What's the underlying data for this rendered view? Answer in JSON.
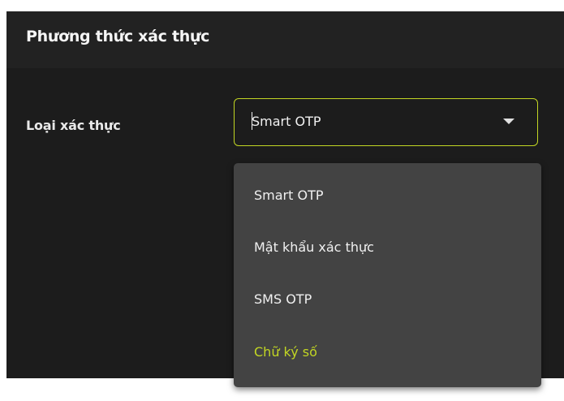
{
  "panel": {
    "title": "Phương thức xác thực"
  },
  "field": {
    "label": "Loại xác thực",
    "selected_value": "Smart OTP",
    "icon": "chevron-down-icon"
  },
  "dropdown": {
    "options": [
      {
        "label": "Smart OTP",
        "selected": false
      },
      {
        "label": "Mật khẩu xác thực",
        "selected": false
      },
      {
        "label": "SMS OTP",
        "selected": false
      },
      {
        "label": "Chữ ký số",
        "selected": true
      }
    ]
  },
  "colors": {
    "accent": "#c2d623",
    "background": "#1c1c1c",
    "menu_background": "#434343",
    "text": "#f0f0f0"
  }
}
